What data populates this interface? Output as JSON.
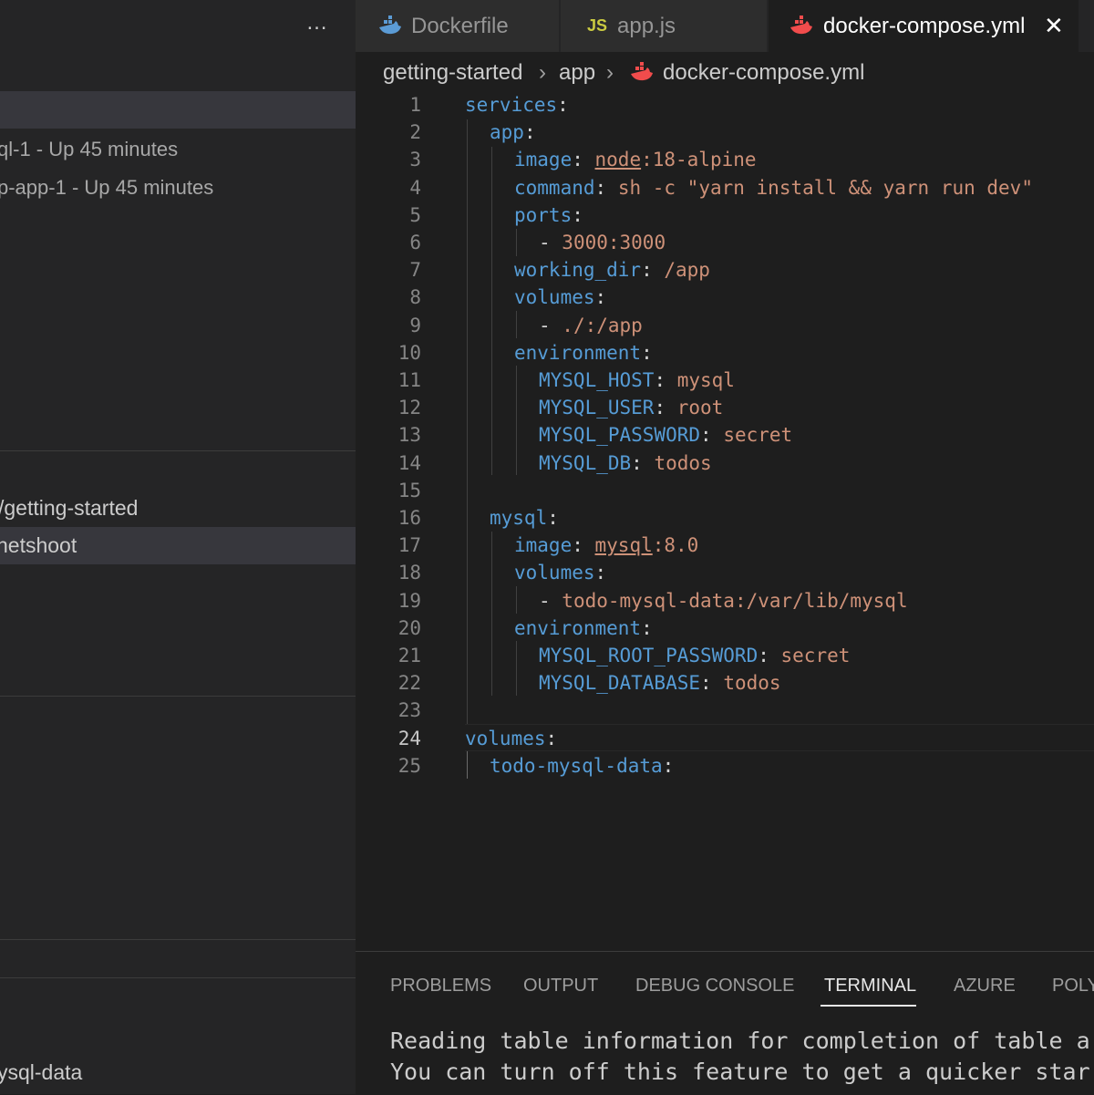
{
  "sidebar": {
    "more_icon": "…",
    "rows": [
      "ql-1 - Up 45 minutes",
      "p-app-1 - Up 45 minutes",
      "/getting-started",
      "netshoot",
      "ysql-data"
    ]
  },
  "tabs": [
    {
      "label": "Dockerfile",
      "icon": "docker-whale-icon"
    },
    {
      "label": "app.js",
      "icon_text": "JS"
    },
    {
      "label": "docker-compose.yml",
      "icon": "docker-whale-icon",
      "close": "✕"
    }
  ],
  "breadcrumb": {
    "items": [
      "getting-started",
      "app",
      "docker-compose.yml"
    ],
    "separator": "›"
  },
  "editor": {
    "current_line": 24,
    "lines": [
      [
        [
          "k",
          "services"
        ],
        [
          "p",
          ":"
        ]
      ],
      [
        [
          "k",
          "app"
        ],
        [
          "p",
          ":"
        ]
      ],
      [
        [
          "k",
          "image"
        ],
        [
          "p",
          ": "
        ],
        [
          "v",
          "node"
        ],
        [
          "v",
          ":18-alpine"
        ]
      ],
      [
        [
          "k",
          "command"
        ],
        [
          "p",
          ": "
        ],
        [
          "v",
          "sh -c \"yarn install && yarn run dev\""
        ]
      ],
      [
        [
          "k",
          "ports"
        ],
        [
          "p",
          ":"
        ]
      ],
      [
        [
          "p",
          "- "
        ],
        [
          "v",
          "3000:3000"
        ]
      ],
      [
        [
          "k",
          "working_dir"
        ],
        [
          "p",
          ": "
        ],
        [
          "v",
          "/app"
        ]
      ],
      [
        [
          "k",
          "volumes"
        ],
        [
          "p",
          ":"
        ]
      ],
      [
        [
          "p",
          "- "
        ],
        [
          "v",
          "./:/app"
        ]
      ],
      [
        [
          "k",
          "environment"
        ],
        [
          "p",
          ":"
        ]
      ],
      [
        [
          "k",
          "MYSQL_HOST"
        ],
        [
          "p",
          ": "
        ],
        [
          "v",
          "mysql"
        ]
      ],
      [
        [
          "k",
          "MYSQL_USER"
        ],
        [
          "p",
          ": "
        ],
        [
          "v",
          "root"
        ]
      ],
      [
        [
          "k",
          "MYSQL_PASSWORD"
        ],
        [
          "p",
          ": "
        ],
        [
          "v",
          "secret"
        ]
      ],
      [
        [
          "k",
          "MYSQL_DB"
        ],
        [
          "p",
          ": "
        ],
        [
          "v",
          "todos"
        ]
      ],
      [],
      [
        [
          "k",
          "mysql"
        ],
        [
          "p",
          ":"
        ]
      ],
      [
        [
          "k",
          "image"
        ],
        [
          "p",
          ": "
        ],
        [
          "v",
          "mysql"
        ],
        [
          "v",
          ":8.0"
        ]
      ],
      [
        [
          "k",
          "volumes"
        ],
        [
          "p",
          ":"
        ]
      ],
      [
        [
          "p",
          "- "
        ],
        [
          "v",
          "todo-mysql-data:/var/lib/mysql"
        ]
      ],
      [
        [
          "k",
          "environment"
        ],
        [
          "p",
          ":"
        ]
      ],
      [
        [
          "k",
          "MYSQL_ROOT_PASSWORD"
        ],
        [
          "p",
          ": "
        ],
        [
          "v",
          "secret"
        ]
      ],
      [
        [
          "k",
          "MYSQL_DATABASE"
        ],
        [
          "p",
          ": "
        ],
        [
          "v",
          "todos"
        ]
      ],
      [],
      [
        [
          "k",
          "volumes"
        ],
        [
          "p",
          ":"
        ]
      ],
      [
        [
          "k",
          "todo-mysql-data"
        ],
        [
          "p",
          ":"
        ]
      ]
    ]
  },
  "panel": {
    "tabs": [
      "PROBLEMS",
      "OUTPUT",
      "DEBUG CONSOLE",
      "TERMINAL",
      "AZURE",
      "POLY"
    ],
    "active_tab": "TERMINAL",
    "terminal_lines": [
      "Reading table information for completion of table a",
      "You can turn off this feature to get a quicker star"
    ]
  },
  "colors": {
    "key": "#569cd6",
    "string": "#ce9178",
    "punct": "#d4d4d4",
    "docker_icon": "#f14c4c",
    "js_icon": "#cbcb41"
  }
}
